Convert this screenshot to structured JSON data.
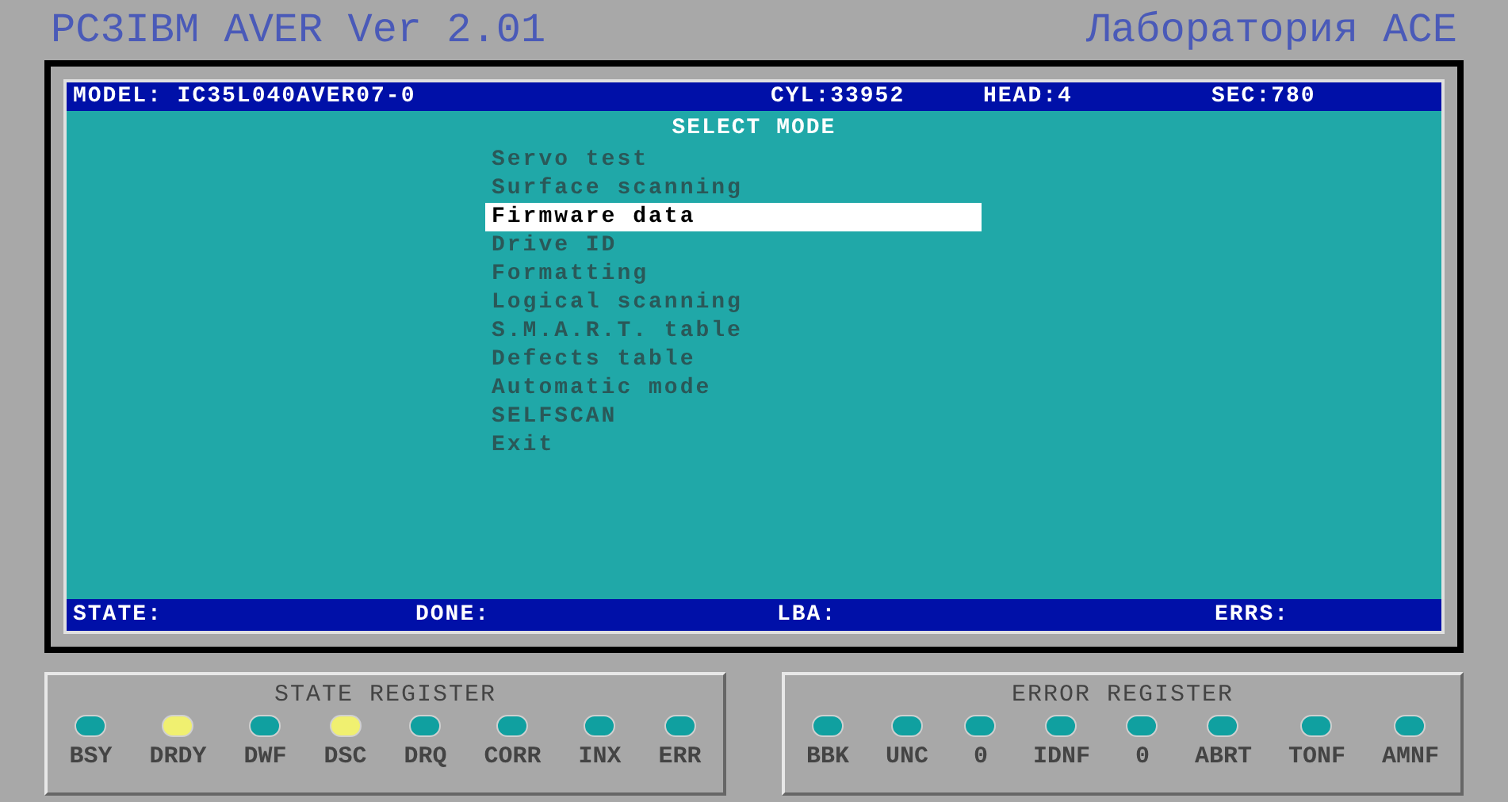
{
  "title": "PC3IBM AVER Ver 2.01",
  "lab": "Лаборатория ACE",
  "header": {
    "model": "MODEL: IC35L040AVER07-0",
    "cyl": "CYL:33952",
    "head": "HEAD:4",
    "sec": "SEC:780"
  },
  "menu_title": "SELECT MODE",
  "menu": [
    {
      "label": "Servo test",
      "selected": false
    },
    {
      "label": "Surface scanning",
      "selected": false
    },
    {
      "label": "Firmware data",
      "selected": true
    },
    {
      "label": "Drive ID",
      "selected": false
    },
    {
      "label": "Formatting",
      "selected": false
    },
    {
      "label": "Logical scanning",
      "selected": false
    },
    {
      "label": "S.M.A.R.T. table",
      "selected": false
    },
    {
      "label": "Defects table",
      "selected": false
    },
    {
      "label": "Automatic mode",
      "selected": false
    },
    {
      "label": "SELFSCAN",
      "selected": false
    },
    {
      "label": "Exit",
      "selected": false
    }
  ],
  "status_bar": [
    "STATE:",
    "DONE:",
    "LBA:",
    "ERRS:"
  ],
  "registers": [
    {
      "title": "STATE REGISTER",
      "bits": [
        {
          "label": "BSY",
          "on": false
        },
        {
          "label": "DRDY",
          "on": true
        },
        {
          "label": "DWF",
          "on": false
        },
        {
          "label": "DSC",
          "on": true
        },
        {
          "label": "DRQ",
          "on": false
        },
        {
          "label": "CORR",
          "on": false
        },
        {
          "label": "INX",
          "on": false
        },
        {
          "label": "ERR",
          "on": false
        }
      ]
    },
    {
      "title": "ERROR REGISTER",
      "bits": [
        {
          "label": "BBK",
          "on": false
        },
        {
          "label": "UNC",
          "on": false
        },
        {
          "label": "0",
          "on": false
        },
        {
          "label": "IDNF",
          "on": false
        },
        {
          "label": "0",
          "on": false
        },
        {
          "label": "ABRT",
          "on": false
        },
        {
          "label": "TONF",
          "on": false
        },
        {
          "label": "AMNF",
          "on": false
        }
      ]
    }
  ]
}
